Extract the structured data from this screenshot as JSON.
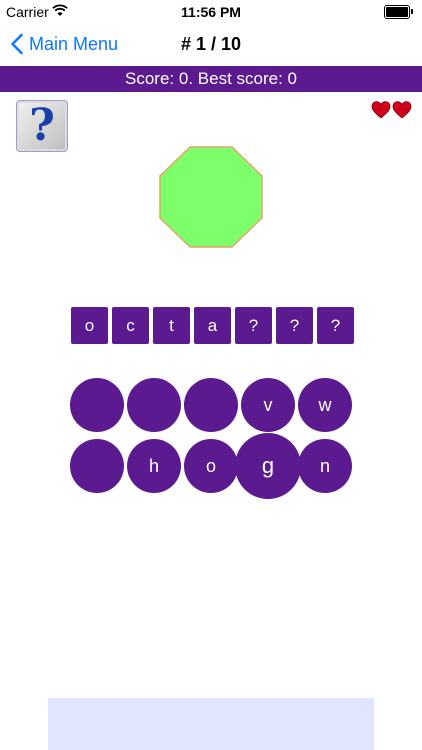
{
  "status_bar": {
    "carrier": "Carrier",
    "time": "11:56 PM"
  },
  "nav": {
    "back_label": "Main Menu",
    "title": "# 1 / 10"
  },
  "score_banner": "Score: 0. Best score: 0",
  "lives": 2,
  "shape": {
    "kind": "octagon",
    "fill": "#7cff6b",
    "stroke": "#e8a468"
  },
  "answer_slots": [
    "o",
    "c",
    "t",
    "a",
    "?",
    "?",
    "?"
  ],
  "letter_rows": [
    [
      "",
      "",
      "",
      "v",
      "w"
    ],
    [
      "",
      "h",
      "o",
      "g",
      "n"
    ]
  ],
  "colors": {
    "accent": "#5b1a8f",
    "link": "#0a7aff",
    "heart": "#d0021b",
    "ad_background": "#e1e6ff"
  }
}
